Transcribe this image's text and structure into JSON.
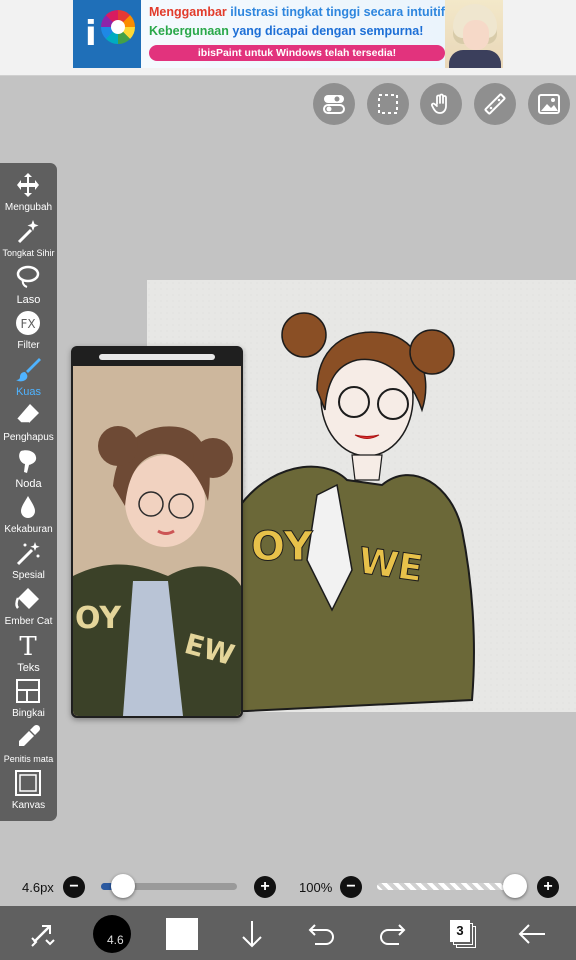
{
  "ad": {
    "line1_part1": "Menggambar",
    "line1_part2": "ilustrasi tingkat tinggi secara intuitif!",
    "line2_part1": "Kebergunaan",
    "line2_part2": "yang dicapai dengan sempurna!",
    "cta": "ibisPaint untuk Windows telah tersedia!"
  },
  "top_toolbar": [
    {
      "icon": "toggle-icon"
    },
    {
      "icon": "selection-icon"
    },
    {
      "icon": "hand-icon"
    },
    {
      "icon": "ruler-icon"
    },
    {
      "icon": "image-icon"
    }
  ],
  "tools": [
    {
      "label": "Mengubah",
      "icon": "move-icon"
    },
    {
      "label": "Tongkat Sihir",
      "icon": "magic-wand-icon"
    },
    {
      "label": "Laso",
      "icon": "lasso-icon"
    },
    {
      "label": "Filter",
      "icon": "fx-icon"
    },
    {
      "label": "Kuas",
      "icon": "brush-icon",
      "active": true
    },
    {
      "label": "Penghapus",
      "icon": "eraser-icon"
    },
    {
      "label": "Noda",
      "icon": "smudge-icon"
    },
    {
      "label": "Kekaburan",
      "icon": "blur-icon"
    },
    {
      "label": "Spesial",
      "icon": "special-icon"
    },
    {
      "label": "Ember Cat",
      "icon": "fill-bucket-icon"
    },
    {
      "label": "Teks",
      "icon": "text-icon"
    },
    {
      "label": "Bingkai",
      "icon": "frame-icon"
    },
    {
      "label": "Penitis mata",
      "icon": "eyedropper-icon"
    },
    {
      "label": "Kanvas",
      "icon": "canvas-icon"
    }
  ],
  "brush": {
    "size_label": "4.6px",
    "size_fraction": 0.16,
    "opacity_label": "100%",
    "opacity_fraction": 1.0
  },
  "bottom": {
    "brush_size_badge": "4.6",
    "layer_count": "3"
  },
  "colors": {
    "accent": "#4fb3ff",
    "current_color": "#000000",
    "secondary_color": "#ffffff"
  }
}
